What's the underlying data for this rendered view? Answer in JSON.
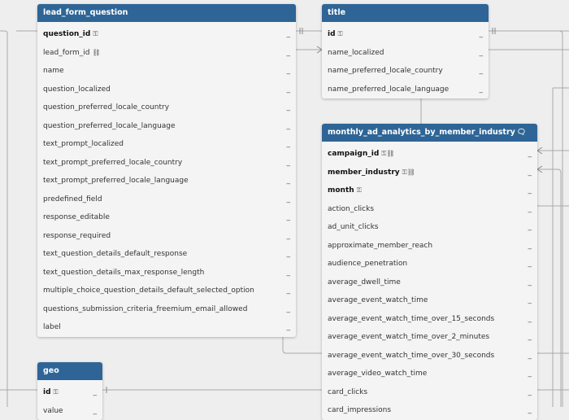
{
  "tables": [
    {
      "id": "lead_form_question",
      "title": "lead_form_question",
      "header_icon": "",
      "columns": [
        {
          "label": "question_id",
          "pk": true,
          "icons": "⚿",
          "icon_name": "key-icon",
          "type": "_"
        },
        {
          "label": "lead_form_id",
          "pk": false,
          "icons": "⛓",
          "icon_name": "link-icon",
          "type": "_"
        },
        {
          "label": "name",
          "pk": false,
          "icons": "",
          "type": "_"
        },
        {
          "label": "question_localized",
          "pk": false,
          "icons": "",
          "type": "_"
        },
        {
          "label": "question_preferred_locale_country",
          "pk": false,
          "icons": "",
          "type": "_"
        },
        {
          "label": "question_preferred_locale_language",
          "pk": false,
          "icons": "",
          "type": "_"
        },
        {
          "label": "text_prompt_localized",
          "pk": false,
          "icons": "",
          "type": "_"
        },
        {
          "label": "text_prompt_preferred_locale_country",
          "pk": false,
          "icons": "",
          "type": "_"
        },
        {
          "label": "text_prompt_preferred_locale_language",
          "pk": false,
          "icons": "",
          "type": "_"
        },
        {
          "label": "predefined_field",
          "pk": false,
          "icons": "",
          "type": "_"
        },
        {
          "label": "response_editable",
          "pk": false,
          "icons": "",
          "type": "_"
        },
        {
          "label": "response_required",
          "pk": false,
          "icons": "",
          "type": "_"
        },
        {
          "label": "text_question_details_default_response",
          "pk": false,
          "icons": "",
          "type": "_"
        },
        {
          "label": "text_question_details_max_response_length",
          "pk": false,
          "icons": "",
          "type": "_"
        },
        {
          "label": "multiple_choice_question_details_default_selected_option",
          "pk": false,
          "icons": "",
          "type": "_"
        },
        {
          "label": "questions_submission_criteria_freemium_email_allowed",
          "pk": false,
          "icons": "",
          "type": "_"
        },
        {
          "label": "label",
          "pk": false,
          "icons": "",
          "type": "_"
        }
      ]
    },
    {
      "id": "title",
      "title": "title",
      "header_icon": "",
      "columns": [
        {
          "label": "id",
          "pk": true,
          "icons": "⚿",
          "icon_name": "key-icon",
          "type": "_"
        },
        {
          "label": "name_localized",
          "pk": false,
          "icons": "",
          "type": "_"
        },
        {
          "label": "name_preferred_locale_country",
          "pk": false,
          "icons": "",
          "type": "_"
        },
        {
          "label": "name_preferred_locale_language",
          "pk": false,
          "icons": "",
          "type": "_"
        }
      ]
    },
    {
      "id": "monthly_ad_analytics_by_member_industry",
      "title": "monthly_ad_analytics_by_member_industry",
      "header_icon": "🗨",
      "columns": [
        {
          "label": "campaign_id",
          "pk": true,
          "icons": "⚿⛓",
          "icon_name": "key-link-icon",
          "type": "_"
        },
        {
          "label": "member_industry",
          "pk": true,
          "icons": "⚿⛓",
          "icon_name": "key-link-icon",
          "type": "_"
        },
        {
          "label": "month",
          "pk": true,
          "icons": "⚿",
          "icon_name": "key-icon",
          "type": "_"
        },
        {
          "label": "action_clicks",
          "pk": false,
          "icons": "",
          "type": "_"
        },
        {
          "label": "ad_unit_clicks",
          "pk": false,
          "icons": "",
          "type": "_"
        },
        {
          "label": "approximate_member_reach",
          "pk": false,
          "icons": "",
          "type": "_"
        },
        {
          "label": "audience_penetration",
          "pk": false,
          "icons": "",
          "type": "_"
        },
        {
          "label": "average_dwell_time",
          "pk": false,
          "icons": "",
          "type": "_"
        },
        {
          "label": "average_event_watch_time",
          "pk": false,
          "icons": "",
          "type": "_"
        },
        {
          "label": "average_event_watch_time_over_15_seconds",
          "pk": false,
          "icons": "",
          "type": "_"
        },
        {
          "label": "average_event_watch_time_over_2_minutes",
          "pk": false,
          "icons": "",
          "type": "_"
        },
        {
          "label": "average_event_watch_time_over_30_seconds",
          "pk": false,
          "icons": "",
          "type": "_"
        },
        {
          "label": "average_video_watch_time",
          "pk": false,
          "icons": "",
          "type": "_"
        },
        {
          "label": "card_clicks",
          "pk": false,
          "icons": "",
          "type": "_"
        },
        {
          "label": "card_impressions",
          "pk": false,
          "icons": "",
          "type": "_"
        }
      ]
    },
    {
      "id": "geo",
      "title": "geo",
      "header_icon": "",
      "columns": [
        {
          "label": "id",
          "pk": true,
          "icons": "⚿",
          "icon_name": "key-icon",
          "type": "_"
        },
        {
          "label": "value",
          "pk": false,
          "icons": "",
          "type": "_"
        }
      ]
    }
  ],
  "colors": {
    "header_bg": "#2e6596",
    "header_text": "#ffffff",
    "card_bg": "#f4f4f4",
    "canvas_bg": "#eeeeee",
    "connector": "#a9a9a9"
  }
}
